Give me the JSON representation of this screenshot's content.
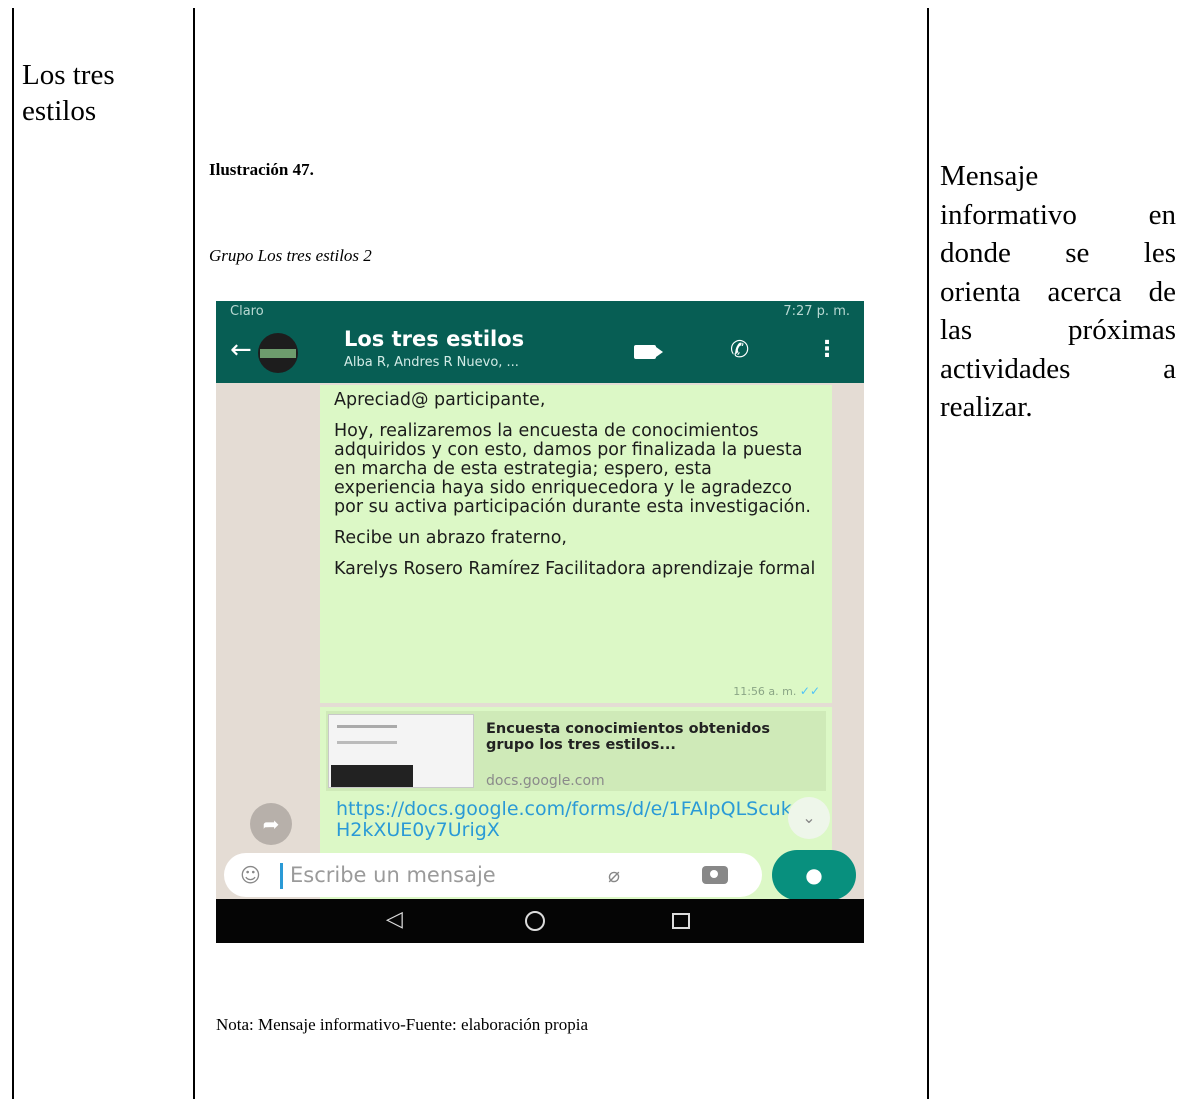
{
  "left_cell": {
    "text": "Los tres estilos"
  },
  "figure": {
    "label": "Ilustración 47.",
    "title": "Grupo Los tres estilos 2",
    "note": "Nota: Mensaje informativo-Fuente: elaboración propia"
  },
  "right_cell": {
    "lines": [
      "Mensaje",
      "informativo en",
      "donde se les",
      "orienta acerca de",
      "las próximas",
      "actividades a",
      "realizar."
    ]
  },
  "screenshot": {
    "status_left": "Claro",
    "status_right": "7:27 p. m.",
    "header": {
      "back_glyph": "←",
      "group_name": "Los tres estilos",
      "members": "Alba R, Andres R Nuevo, ..."
    },
    "message": {
      "paragraphs": [
        "Apreciad@ participante,",
        "Hoy, realizaremos la encuesta de conocimientos adquiridos y con esto, damos por finalizada la puesta en marcha de esta estrategia; espero, esta experiencia haya sido enriquecedora y le agradezco por su activa participación durante esta investigación.",
        "Recibe un abrazo fraterno,",
        "Karelys Rosero Ramírez Facilitadora aprendizaje formal"
      ],
      "time": "11:56 a. m.",
      "read_ticks": "✓✓"
    },
    "link_message": {
      "preview_title": "Encuesta conocimientos obtenidos grupo los tres estilos...",
      "preview_domain": "docs.google.com",
      "url": "https://docs.google.com/forms/d/e/1FAIpQLScukoH2kXUE0y7UrigX"
    },
    "input": {
      "placeholder": "Escribe un mensaje"
    },
    "colors": {
      "header": "#075e54",
      "bubble": "#dcf8c6",
      "link": "#2a9ad6",
      "mic": "#08907e",
      "wallpaper": "#e4dcd4"
    }
  }
}
